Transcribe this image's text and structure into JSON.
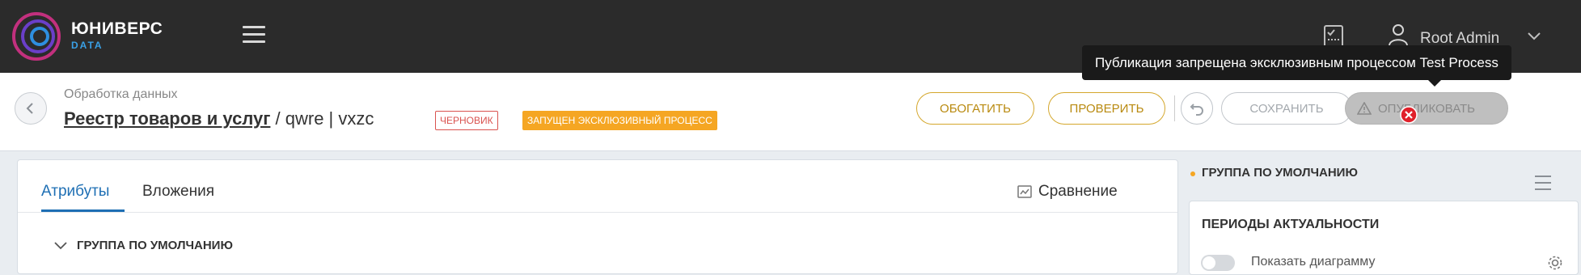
{
  "app": {
    "logo_title": "ЮНИВЕРС",
    "logo_subtitle": "DATA",
    "user_name": "Root Admin"
  },
  "tooltip": "Публикация запрещена эксклюзивным процессом Test Process",
  "header": {
    "breadcrumb": "Обработка данных",
    "entity_link": "Реестр товаров и услуг",
    "record_suffix": " / qwre | vxzc",
    "badge_draft": "ЧЕРНОВИК",
    "badge_process": "ЗАПУЩЕН ЭКСКЛЮЗИВНЫЙ ПРОЦЕСС",
    "buttons": {
      "enrich": "ОБОГАТИТЬ",
      "check": "ПРОВЕРИТЬ",
      "save": "СОХРАНИТЬ",
      "publish": "ОПУБЛИКОВАТЬ"
    }
  },
  "main": {
    "tabs": [
      {
        "label": "Атрибуты",
        "active": true
      },
      {
        "label": "Вложения",
        "active": false
      }
    ],
    "compare_label": "Сравнение",
    "group_title": "ГРУППА ПО УМОЛЧАНИЮ"
  },
  "sidebar": {
    "group_title": "ГРУППА ПО УМОЛЧАНИЮ",
    "periods_title": "ПЕРИОДЫ АКТУАЛЬНОСТИ",
    "show_diagram_label": "Показать диаграмму"
  },
  "colors": {
    "accent_blue": "#1e6fb4",
    "accent_gold": "#d4a72c",
    "badge_orange": "#f5a623",
    "error_red": "#d9534f"
  }
}
